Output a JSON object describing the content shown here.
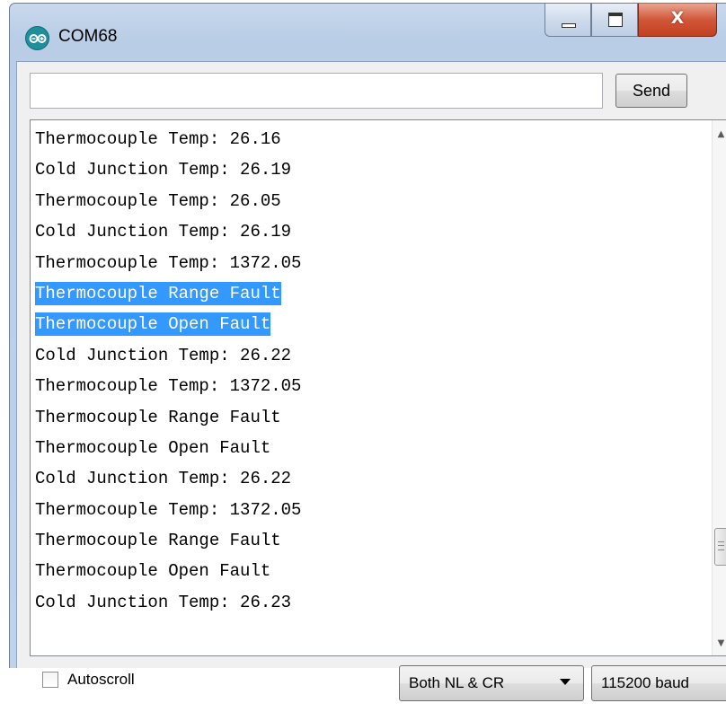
{
  "window": {
    "title": "COM68",
    "icon": "arduino-icon",
    "controls": {
      "minimize": "minimize-icon",
      "maximize": "maximize-icon",
      "close": "close-icon",
      "close_glyph": "X"
    }
  },
  "send_bar": {
    "input_value": "",
    "send_label": "Send"
  },
  "output": {
    "lines": [
      {
        "text": "Thermocouple Temp: 26.16",
        "selected": false
      },
      {
        "text": "Cold Junction Temp: 26.19",
        "selected": false
      },
      {
        "text": "Thermocouple Temp: 26.05",
        "selected": false
      },
      {
        "text": "Cold Junction Temp: 26.19",
        "selected": false
      },
      {
        "text": "Thermocouple Temp: 1372.05",
        "selected": false
      },
      {
        "text": "Thermocouple Range Fault",
        "selected": true
      },
      {
        "text": "Thermocouple Open Fault",
        "selected": true
      },
      {
        "text": "Cold Junction Temp: 26.22",
        "selected": false
      },
      {
        "text": "Thermocouple Temp: 1372.05",
        "selected": false
      },
      {
        "text": "Thermocouple Range Fault",
        "selected": false
      },
      {
        "text": "Thermocouple Open Fault",
        "selected": false
      },
      {
        "text": "Cold Junction Temp: 26.22",
        "selected": false
      },
      {
        "text": "Thermocouple Temp: 1372.05",
        "selected": false
      },
      {
        "text": "Thermocouple Range Fault",
        "selected": false
      },
      {
        "text": "Thermocouple Open Fault",
        "selected": false
      },
      {
        "text": "Cold Junction Temp: 26.23",
        "selected": false
      }
    ],
    "selection_color": "#3399ff"
  },
  "bottom_bar": {
    "autoscroll_label": "Autoscroll",
    "autoscroll_checked": false,
    "line_ending": "Both NL & CR",
    "baud_rate": "115200 baud"
  }
}
